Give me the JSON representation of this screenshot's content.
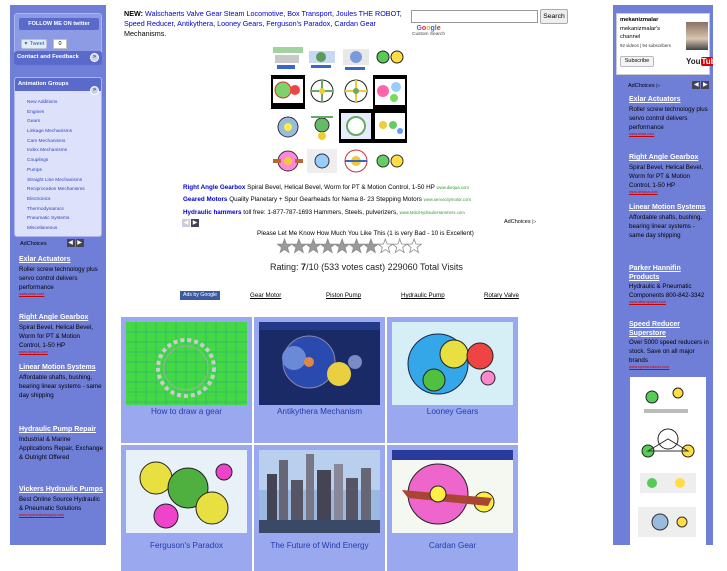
{
  "left_sidebar": {
    "twitter": {
      "title": "FOLLOW ME ON twitter",
      "tweet_label": "Tweet",
      "tweet_count": "0"
    },
    "contact": {
      "label": "Contact and Feedback"
    },
    "animation_groups": {
      "title": "Animation Groups",
      "items": [
        "New Additions",
        "Engines",
        "Gears",
        "Linkage Mechanisms",
        "Cam Mechanisms",
        "Index Mechanisms",
        "Couplings",
        "Pumps",
        "Straight Line Mechanisms",
        "Reciprocation Mechanisms",
        "Electronics",
        "Thermodynamics",
        "Pneumatic Systems",
        "Miscellaneous"
      ]
    },
    "adchoices": "AdChoices",
    "ads": [
      {
        "title": "Exlar Actuators",
        "desc": "Roller screw technology plus servo control delivers performance",
        "url": "www.exlar.com"
      },
      {
        "title": "Right Angle Gearbox",
        "desc": "Spiral Bevel, Helical Bevel, Worm for PT & Motion Control, 1-50 HP",
        "url": "www.diequa.com"
      },
      {
        "title": "Linear Motion Systems",
        "desc": "Affordable shafts, bushing, bearing linear systems - same day shipping",
        "url": ""
      },
      {
        "title": "Hydraulic Pump Repair",
        "desc": "Industrial & Marine Applications Repair, Exchange & Outright Offered",
        "url": ""
      },
      {
        "title": "Vickers Hydraulic Pumps",
        "desc": "Best Online Source Hydraulic & Pneumatic Solutions",
        "url": "www.hydraulicssupply.com"
      }
    ]
  },
  "header": {
    "new_prefix": "NEW:",
    "new_links": [
      "Walschaerts Valve Gear Steam Locomotive",
      "Box Transport",
      "Joules THE ROBOT",
      "Speed Reducer",
      "Antikythera",
      "Looney Gears",
      "Ferguson's Paradox",
      "Cardan Gear"
    ],
    "new_suffix": "Mechanisms.",
    "search_button": "Search",
    "search_value": "",
    "custom_search": "Custom Search",
    "google": "Google"
  },
  "center_ads": [
    {
      "title": "Right Angle Gearbox",
      "desc": "Spiral Bevel, Helical Bevel, Worm for PT & Motion Control, 1-50 HP",
      "url": "www.diequa.com"
    },
    {
      "title": "Geared Motors",
      "desc": "Quality Planetary + Spur Gearheads for Nema 8- 23 Stepping Motors",
      "url": "www.servocitymotor.com"
    },
    {
      "title": "Hydraulic hammers",
      "desc": "toll free: 1-877-787-1693 Hammers, Steels, pulverizers,",
      "url": "www.MdciHydraulicHammers.com"
    }
  ],
  "center_adchoices": "AdChoices",
  "rating": {
    "prompt": "Please Let Me Know How Much You Like This (1 is very Bad - 10 is Excellent)",
    "label_prefix": "Rating:",
    "score": "7",
    "scale": "/10",
    "votes": "(533 votes cast)",
    "visits": "229060 Total Visits",
    "stars_filled": 7,
    "stars_total": 10
  },
  "link_unit": {
    "ads_by": "Ads by Google",
    "links": [
      "Gear Motor",
      "Piston Pump",
      "Hydraulic Pump",
      "Rotary Valve"
    ]
  },
  "tiles": [
    {
      "caption": "How to draw a gear"
    },
    {
      "caption": "Antikythera Mechanism"
    },
    {
      "caption": "Looney Gears"
    },
    {
      "caption": "Ferguson's Paradox"
    },
    {
      "caption": "The Future of Wind Energy"
    },
    {
      "caption": "Cardan Gear"
    }
  ],
  "right_sidebar": {
    "youtube": {
      "name": "mekanizmalar",
      "channel": "mekanizmalar's channel",
      "stats": "92 videos | 94 subscribers",
      "subscribe": "Subscribe",
      "logo_you": "You",
      "logo_tube": "Tube"
    },
    "adchoices": "AdChoices",
    "ads": [
      {
        "title": "Exlar Actuators",
        "desc": "Roller screw technology plus servo control delivers performance",
        "url": "www.exlar.com"
      },
      {
        "title": "Right Angle Gearbox",
        "desc": "Spiral Bevel, Helical Bevel, Worm for PT & Motion Control, 1-50 HP",
        "url": "www.diequa.com"
      },
      {
        "title": "Linear Motion Systems",
        "desc": "Affordable shafts, bushing, bearing linear systems - same day shipping",
        "url": ""
      },
      {
        "title": "Parker Hannifin Products",
        "desc": "Hydraulic & Pneumatic Components 800-842-3342",
        "url": "www.affordpower.com"
      },
      {
        "title": "Speed Reducer Superstore",
        "desc": "Over 5000 speed reducers in stock. Save on all major brands",
        "url": "www.speedreducer.com"
      }
    ]
  },
  "colors": {
    "sidebar": "#6f7fd8",
    "tile_bg": "#9aa8f0",
    "link": "#0000cc",
    "caption": "#223ca8"
  }
}
